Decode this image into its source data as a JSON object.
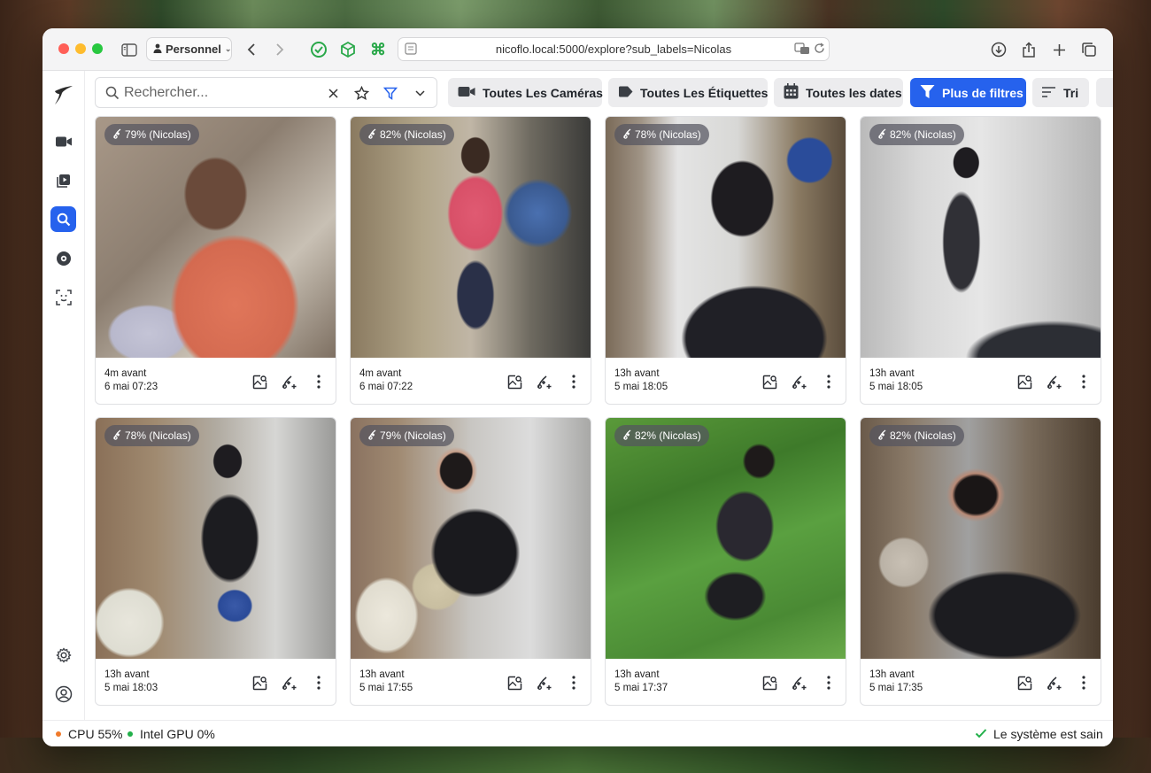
{
  "browser": {
    "profile_label": "Personnel",
    "url": "nicoflo.local:5000/explore?sub_labels=Nicolas"
  },
  "search": {
    "placeholder": "Rechercher..."
  },
  "filters": {
    "cameras_label": "Toutes Les Caméras",
    "labels_label": "Toutes Les Étiquettes",
    "dates_label": "Toutes les dates",
    "more_filters_label": "Plus de filtres",
    "sort_label": "Tri"
  },
  "accent_color": "#2662ed",
  "cards": [
    {
      "badge": "79% (Nicolas)",
      "ago": "4m avant",
      "date": "6 mai 07:23"
    },
    {
      "badge": "82% (Nicolas)",
      "ago": "4m avant",
      "date": "6 mai 07:22"
    },
    {
      "badge": "78% (Nicolas)",
      "ago": "13h avant",
      "date": "5 mai 18:05"
    },
    {
      "badge": "82% (Nicolas)",
      "ago": "13h avant",
      "date": "5 mai 18:05"
    },
    {
      "badge": "78% (Nicolas)",
      "ago": "13h avant",
      "date": "5 mai 18:03"
    },
    {
      "badge": "79% (Nicolas)",
      "ago": "13h avant",
      "date": "5 mai 17:55"
    },
    {
      "badge": "82% (Nicolas)",
      "ago": "13h avant",
      "date": "5 mai 17:37"
    },
    {
      "badge": "82% (Nicolas)",
      "ago": "13h avant",
      "date": "5 mai 17:35"
    }
  ],
  "status": {
    "cpu": "CPU 55%",
    "gpu": "Intel GPU 0%",
    "health": "Le système est sain",
    "cpu_color": "#f07a2a",
    "gpu_color": "#22b04a",
    "health_color": "#22b04a"
  }
}
